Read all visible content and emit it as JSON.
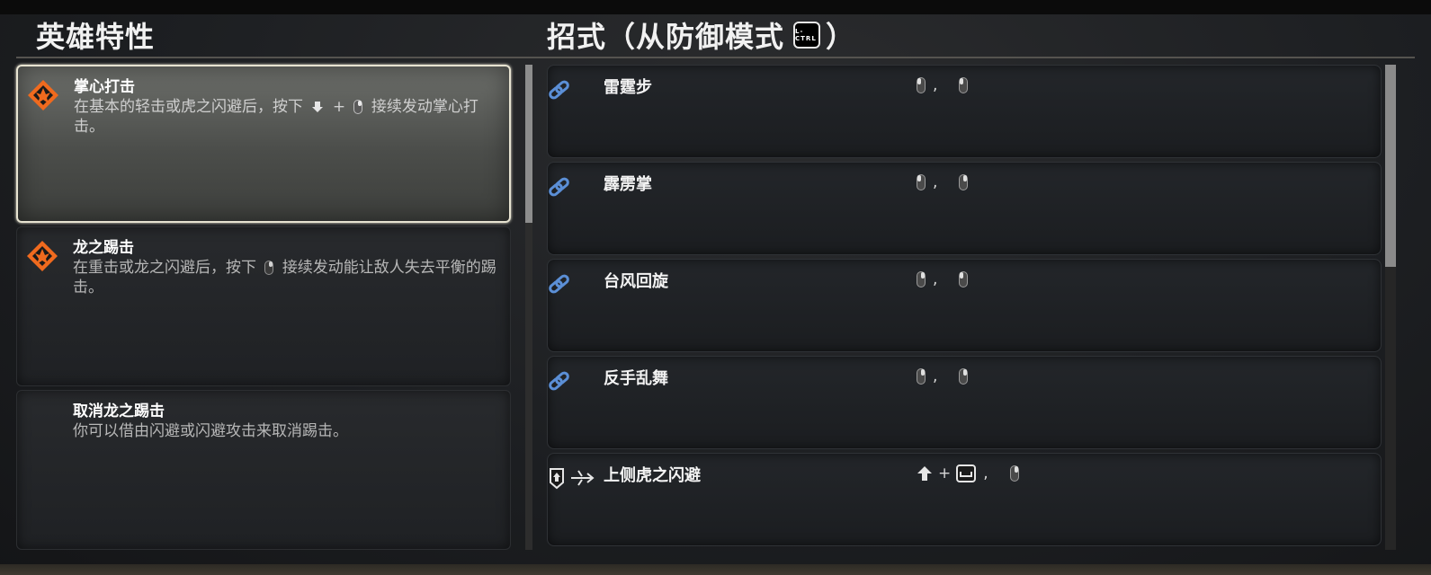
{
  "header": {
    "left_title": "英雄特性",
    "right_title_prefix": "招式（从防御模式",
    "right_title_key": "L-CTRL",
    "right_title_suffix": "）"
  },
  "traits": [
    {
      "name": "掌心打击",
      "desc_before": "在基本的轻击或虎之闪避后，按下",
      "desc_plus": "+",
      "desc_after": "接续发动掌心打击。",
      "icon": "dragon-emblem-icon",
      "selected": true
    },
    {
      "name": "龙之踢击",
      "desc_before": "在重击或龙之闪避后，按下",
      "desc_after": "接续发动能让敌人失去平衡的踢击。",
      "icon": "dragon-emblem-icon",
      "selected": false
    },
    {
      "name": "取消龙之踢击",
      "desc": "你可以借由闪避或闪避攻击来取消踢击。",
      "selected": false
    }
  ],
  "moves": [
    {
      "name": "雷霆步",
      "separator": ",",
      "icon": "chain-link-icon"
    },
    {
      "name": "霹雳掌",
      "separator": ",",
      "icon": "chain-link-icon"
    },
    {
      "name": "台风回旋",
      "separator": ",",
      "icon": "chain-link-icon"
    },
    {
      "name": "反手乱舞",
      "separator": ",",
      "icon": "chain-link-icon"
    },
    {
      "name": "上侧虎之闪避",
      "plus": "+",
      "separator": ",",
      "icon": "shield-dodge-icon"
    }
  ],
  "colors": {
    "accent_orange": "#f06a1e",
    "link_blue": "#5b8fd6",
    "selected_border": "#e7e3d1"
  }
}
